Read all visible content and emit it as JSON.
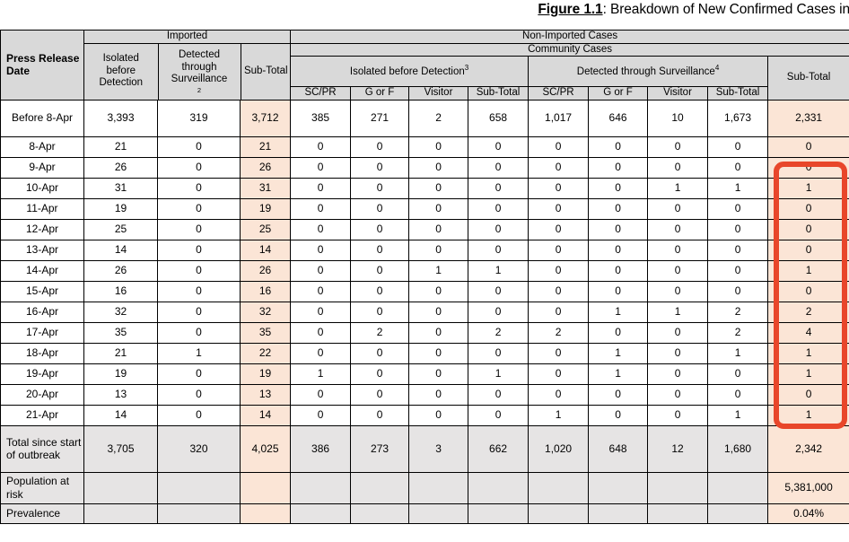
{
  "figure": {
    "label": "Figure 1.1",
    "separator": ": ",
    "title": "Breakdown of New Confirmed Cases in the l"
  },
  "table": {
    "corner_header": "Press Release Date",
    "group_imported": "Imported",
    "group_non_imported": "Non-Imported Cases",
    "group_community": "Community Cases",
    "group_isolated_before_detection": "Isolated before Detection",
    "group_isolated_before_detection_sup": "3",
    "group_detected_through_surveillance": "Detected through Surveillance",
    "group_detected_through_surveillance_sup": "4",
    "imported_cols": [
      {
        "label": "Isolated before Detection",
        "sup": ""
      },
      {
        "label": "Detected through Surveillance",
        "sup": "2"
      },
      {
        "label": "Sub-Total",
        "sup": ""
      }
    ],
    "leaf_cols": [
      "SC/PR",
      "G or F",
      "Visitor",
      "Sub-Total",
      "SC/PR",
      "G or F",
      "Visitor",
      "Sub-Total"
    ],
    "grand_subtotal_col": "Sub-Total",
    "rows": [
      {
        "date": "Before 8-Apr",
        "v": [
          "3,393",
          "319",
          "3,712",
          "385",
          "271",
          "2",
          "658",
          "1,017",
          "646",
          "10",
          "1,673",
          "2,331"
        ]
      },
      {
        "date": "8-Apr",
        "v": [
          "21",
          "0",
          "21",
          "0",
          "0",
          "0",
          "0",
          "0",
          "0",
          "0",
          "0",
          "0"
        ]
      },
      {
        "date": "9-Apr",
        "v": [
          "26",
          "0",
          "26",
          "0",
          "0",
          "0",
          "0",
          "0",
          "0",
          "0",
          "0",
          "0"
        ]
      },
      {
        "date": "10-Apr",
        "v": [
          "31",
          "0",
          "31",
          "0",
          "0",
          "0",
          "0",
          "0",
          "0",
          "1",
          "1",
          "1"
        ]
      },
      {
        "date": "11-Apr",
        "v": [
          "19",
          "0",
          "19",
          "0",
          "0",
          "0",
          "0",
          "0",
          "0",
          "0",
          "0",
          "0"
        ]
      },
      {
        "date": "12-Apr",
        "v": [
          "25",
          "0",
          "25",
          "0",
          "0",
          "0",
          "0",
          "0",
          "0",
          "0",
          "0",
          "0"
        ]
      },
      {
        "date": "13-Apr",
        "v": [
          "14",
          "0",
          "14",
          "0",
          "0",
          "0",
          "0",
          "0",
          "0",
          "0",
          "0",
          "0"
        ]
      },
      {
        "date": "14-Apr",
        "v": [
          "26",
          "0",
          "26",
          "0",
          "0",
          "1",
          "1",
          "0",
          "0",
          "0",
          "0",
          "1"
        ]
      },
      {
        "date": "15-Apr",
        "v": [
          "16",
          "0",
          "16",
          "0",
          "0",
          "0",
          "0",
          "0",
          "0",
          "0",
          "0",
          "0"
        ]
      },
      {
        "date": "16-Apr",
        "v": [
          "32",
          "0",
          "32",
          "0",
          "0",
          "0",
          "0",
          "0",
          "1",
          "1",
          "2",
          "2"
        ]
      },
      {
        "date": "17-Apr",
        "v": [
          "35",
          "0",
          "35",
          "0",
          "2",
          "0",
          "2",
          "2",
          "0",
          "0",
          "2",
          "4"
        ]
      },
      {
        "date": "18-Apr",
        "v": [
          "21",
          "1",
          "22",
          "0",
          "0",
          "0",
          "0",
          "0",
          "1",
          "0",
          "1",
          "1"
        ]
      },
      {
        "date": "19-Apr",
        "v": [
          "19",
          "0",
          "19",
          "1",
          "0",
          "0",
          "1",
          "0",
          "1",
          "0",
          "0",
          "1"
        ]
      },
      {
        "date": "20-Apr",
        "v": [
          "13",
          "0",
          "13",
          "0",
          "0",
          "0",
          "0",
          "0",
          "0",
          "0",
          "0",
          "0"
        ]
      },
      {
        "date": "21-Apr",
        "v": [
          "14",
          "0",
          "14",
          "0",
          "0",
          "0",
          "0",
          "1",
          "0",
          "0",
          "1",
          "1"
        ]
      }
    ],
    "summary_rows": [
      {
        "label": "Total since start of outbreak",
        "v": [
          "3,705",
          "320",
          "4,025",
          "386",
          "273",
          "3",
          "662",
          "1,020",
          "648",
          "12",
          "1,680",
          "2,342"
        ]
      },
      {
        "label": "Population at risk",
        "v": [
          "",
          "",
          "",
          "",
          "",
          "",
          "",
          "",
          "",
          "",
          "",
          "5,381,000"
        ]
      },
      {
        "label": "Prevalence",
        "v": [
          "",
          "",
          "",
          "",
          "",
          "",
          "",
          "",
          "",
          "",
          "",
          "0.04%"
        ]
      }
    ]
  },
  "annotation": {
    "highlight_name": "red-outline-box",
    "highlight_color": "#e8462a"
  },
  "colors": {
    "header_grey": "#d9d9d9",
    "summary_grey": "#e6e4e4",
    "subtotal_peach": "#fbe5d6",
    "highlight_red": "#e8462a"
  }
}
